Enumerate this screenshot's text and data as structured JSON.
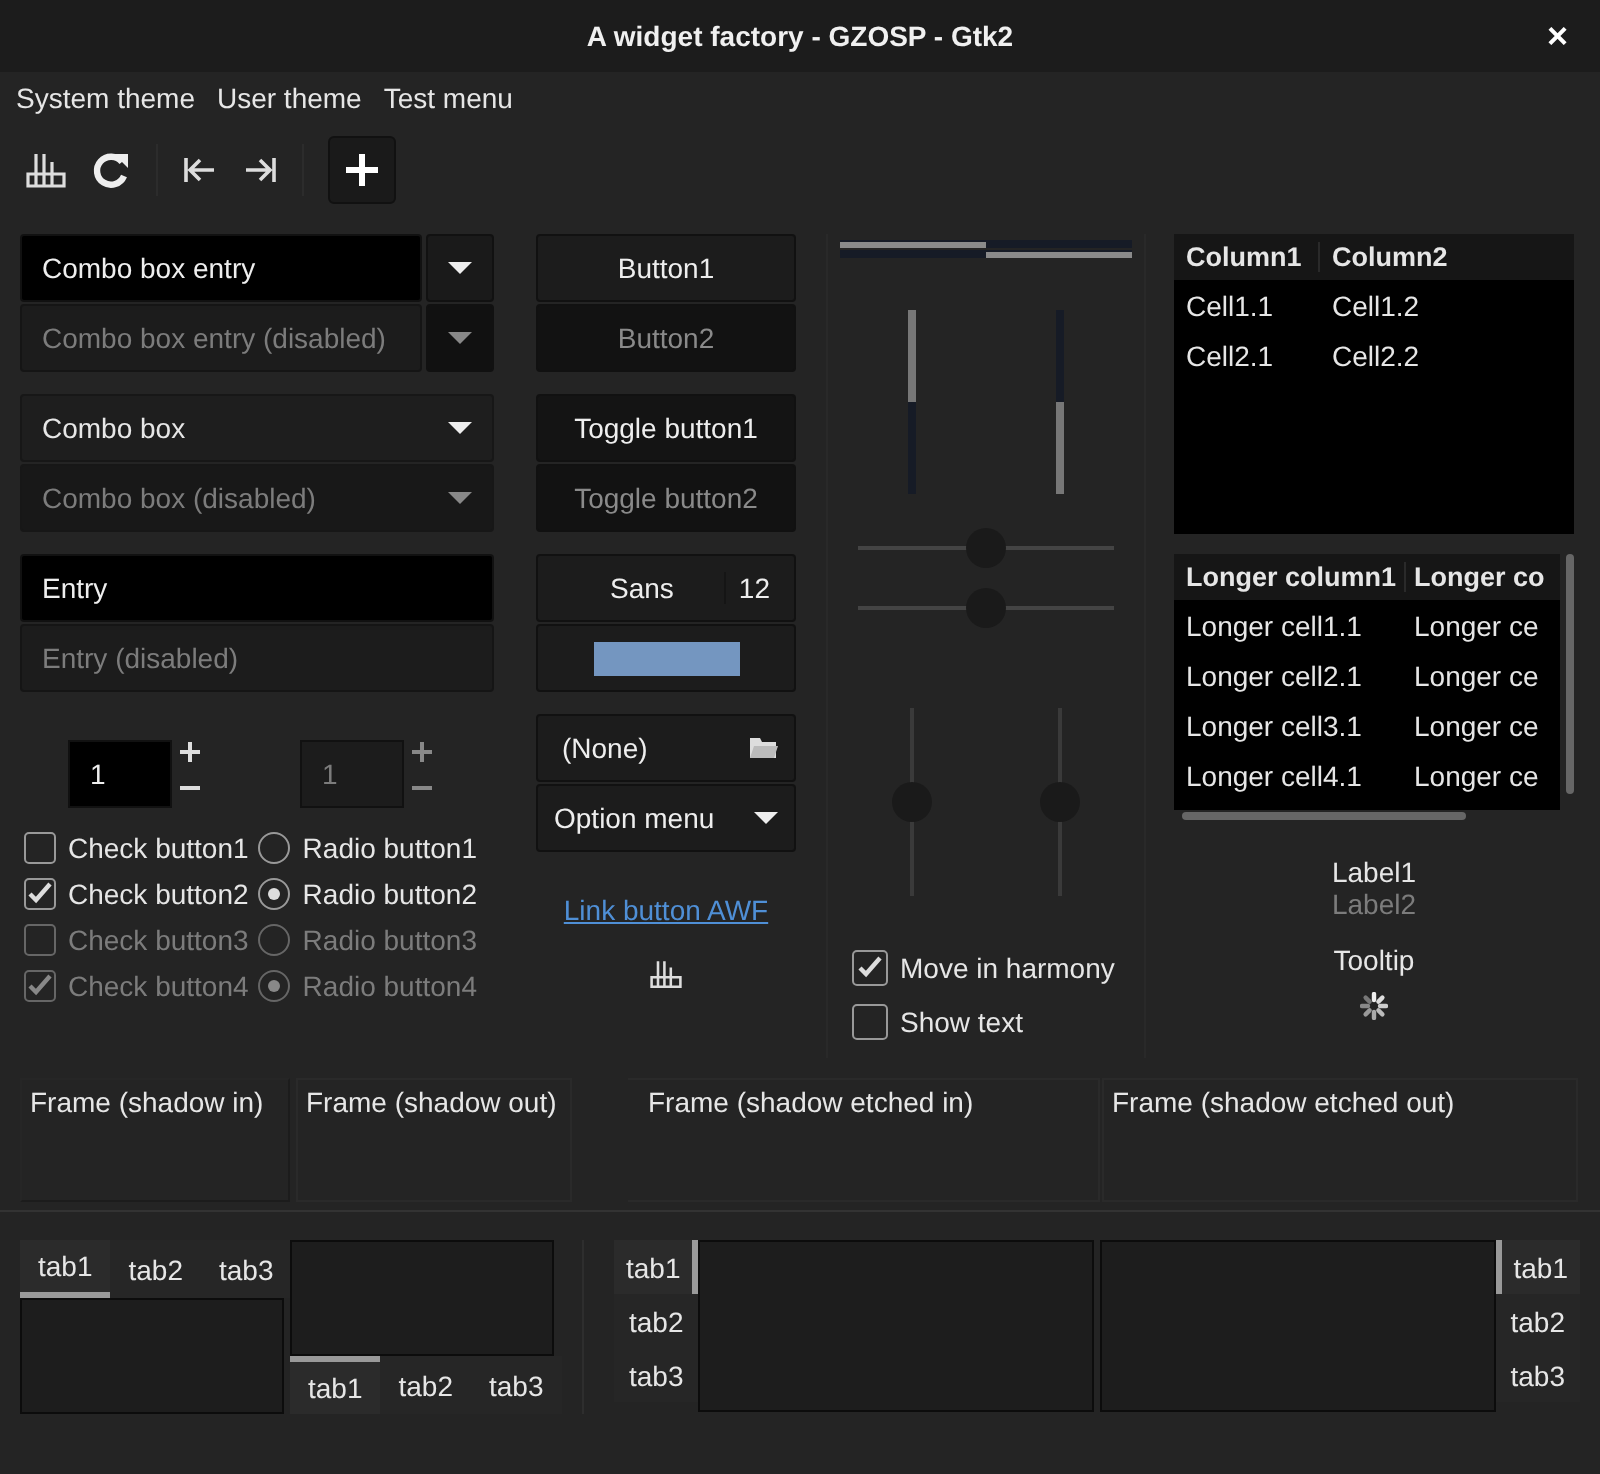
{
  "window": {
    "title": "A widget factory - GZOSP - Gtk2",
    "close": "×"
  },
  "menu": [
    {
      "label": "System theme"
    },
    {
      "label": "User theme"
    },
    {
      "label": "Test menu"
    }
  ],
  "combo_entries": [
    {
      "value": "Combo box entry",
      "disabled": false
    },
    {
      "value": "Combo box entry (disabled)",
      "disabled": true
    }
  ],
  "combos": [
    {
      "value": "Combo box",
      "disabled": false
    },
    {
      "value": "Combo box (disabled)",
      "disabled": true
    }
  ],
  "entries": [
    {
      "value": "Entry",
      "disabled": false
    },
    {
      "value": "Entry (disabled)",
      "disabled": true
    }
  ],
  "spin_buttons": [
    {
      "value": "1",
      "disabled": false
    },
    {
      "value": "1",
      "disabled": true
    }
  ],
  "check_buttons": [
    {
      "label": "Check button1",
      "checked": false,
      "disabled": false
    },
    {
      "label": "Check button2",
      "checked": true,
      "disabled": false
    },
    {
      "label": "Check button3",
      "checked": false,
      "disabled": true
    },
    {
      "label": "Check button4",
      "checked": true,
      "disabled": true
    }
  ],
  "radio_buttons": [
    {
      "label": "Radio button1",
      "selected": false,
      "disabled": false
    },
    {
      "label": "Radio button2",
      "selected": true,
      "disabled": false
    },
    {
      "label": "Radio button3",
      "selected": false,
      "disabled": true
    },
    {
      "label": "Radio button4",
      "selected": true,
      "disabled": true
    }
  ],
  "buttons": [
    {
      "label": "Button1",
      "disabled": false
    },
    {
      "label": "Button2",
      "disabled": true
    }
  ],
  "toggle_buttons": [
    {
      "label": "Toggle button1",
      "disabled": false
    },
    {
      "label": "Toggle button2",
      "disabled": true
    }
  ],
  "font_button": {
    "family": "Sans",
    "size": "12"
  },
  "file_chooser": {
    "value": "(None)"
  },
  "option_menu": {
    "value": "Option menu"
  },
  "link_button": {
    "label": "Link button AWF"
  },
  "progress_horizontal": [
    {
      "level": 0.5,
      "inverted": false
    },
    {
      "level": 0.5,
      "inverted": true
    }
  ],
  "progress_vertical": [
    {
      "level": 0.5,
      "inverted": true
    },
    {
      "level": 0.5,
      "inverted": false
    }
  ],
  "scales_horizontal": [
    {
      "level": 0.5
    },
    {
      "level": 0.5
    }
  ],
  "scales_vertical": [
    {
      "level": 0.5
    },
    {
      "level": 0.5
    }
  ],
  "slider_options": [
    {
      "label": "Move in harmony",
      "checked": true
    },
    {
      "label": "Show text",
      "checked": false
    }
  ],
  "table": {
    "columns": [
      "Column1",
      "Column2"
    ],
    "rows": [
      [
        "Cell1.1",
        "Cell1.2"
      ],
      [
        "Cell2.1",
        "Cell2.2"
      ]
    ]
  },
  "long_table": {
    "columns": [
      "Longer column1",
      "Longer co"
    ],
    "rows": [
      [
        "Longer cell1.1",
        "Longer ce"
      ],
      [
        "Longer cell2.1",
        "Longer ce"
      ],
      [
        "Longer cell3.1",
        "Longer ce"
      ],
      [
        "Longer cell4.1",
        "Longer ce"
      ]
    ]
  },
  "labels": [
    {
      "text": "Label1",
      "disabled": false
    },
    {
      "text": "Label2",
      "disabled": true
    }
  ],
  "tooltip": "Tooltip",
  "frames": [
    "Frame (shadow in)",
    "Frame (shadow out)",
    "Frame (shadow etched in)",
    "Frame (shadow etched out)"
  ],
  "notebooks": [
    {
      "kind": "top",
      "tabs": [
        {
          "label": "tab1",
          "selected": true
        },
        {
          "label": "tab2",
          "selected": false
        },
        {
          "label": "tab3",
          "selected": false
        }
      ]
    },
    {
      "kind": "bottom",
      "tabs": [
        {
          "label": "tab1",
          "selected": true
        },
        {
          "label": "tab2",
          "selected": false
        },
        {
          "label": "tab3",
          "selected": false
        }
      ]
    },
    {
      "kind": "left",
      "tabs": [
        {
          "label": "tab1",
          "selected": true
        },
        {
          "label": "tab2",
          "selected": false
        },
        {
          "label": "tab3",
          "selected": false
        }
      ]
    },
    {
      "kind": "right",
      "tabs": [
        {
          "label": "tab1",
          "selected": true
        },
        {
          "label": "tab2",
          "selected": false
        },
        {
          "label": "tab3",
          "selected": false
        }
      ]
    }
  ]
}
